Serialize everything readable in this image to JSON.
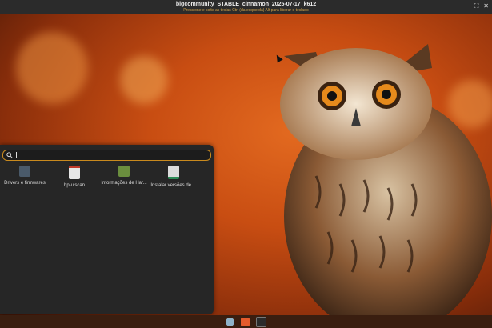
{
  "window": {
    "title": "bigcommunity_STABLE_cinnamon_2025-07-17_k612",
    "subtitle": "Pressione e solte as teclas Ctrl (da esquerda) Alt para liberar o teclado"
  },
  "menu": {
    "search": {
      "value": "",
      "placeholder": ""
    },
    "apps": [
      {
        "label": "Drivers e firmwares",
        "icon": "chip-icon"
      },
      {
        "label": "hp-uiscan",
        "icon": "scanner-icon"
      },
      {
        "label": "Informações de Har...",
        "icon": "hardware-info-icon"
      },
      {
        "label": "Instalar versões de ...",
        "icon": "package-icon"
      }
    ]
  },
  "panel": {
    "icons": [
      "disk-icon",
      "brave-browser-icon",
      "terminal-icon"
    ]
  },
  "colors": {
    "accent": "#c98a1e",
    "menu_bg": "#262626"
  }
}
